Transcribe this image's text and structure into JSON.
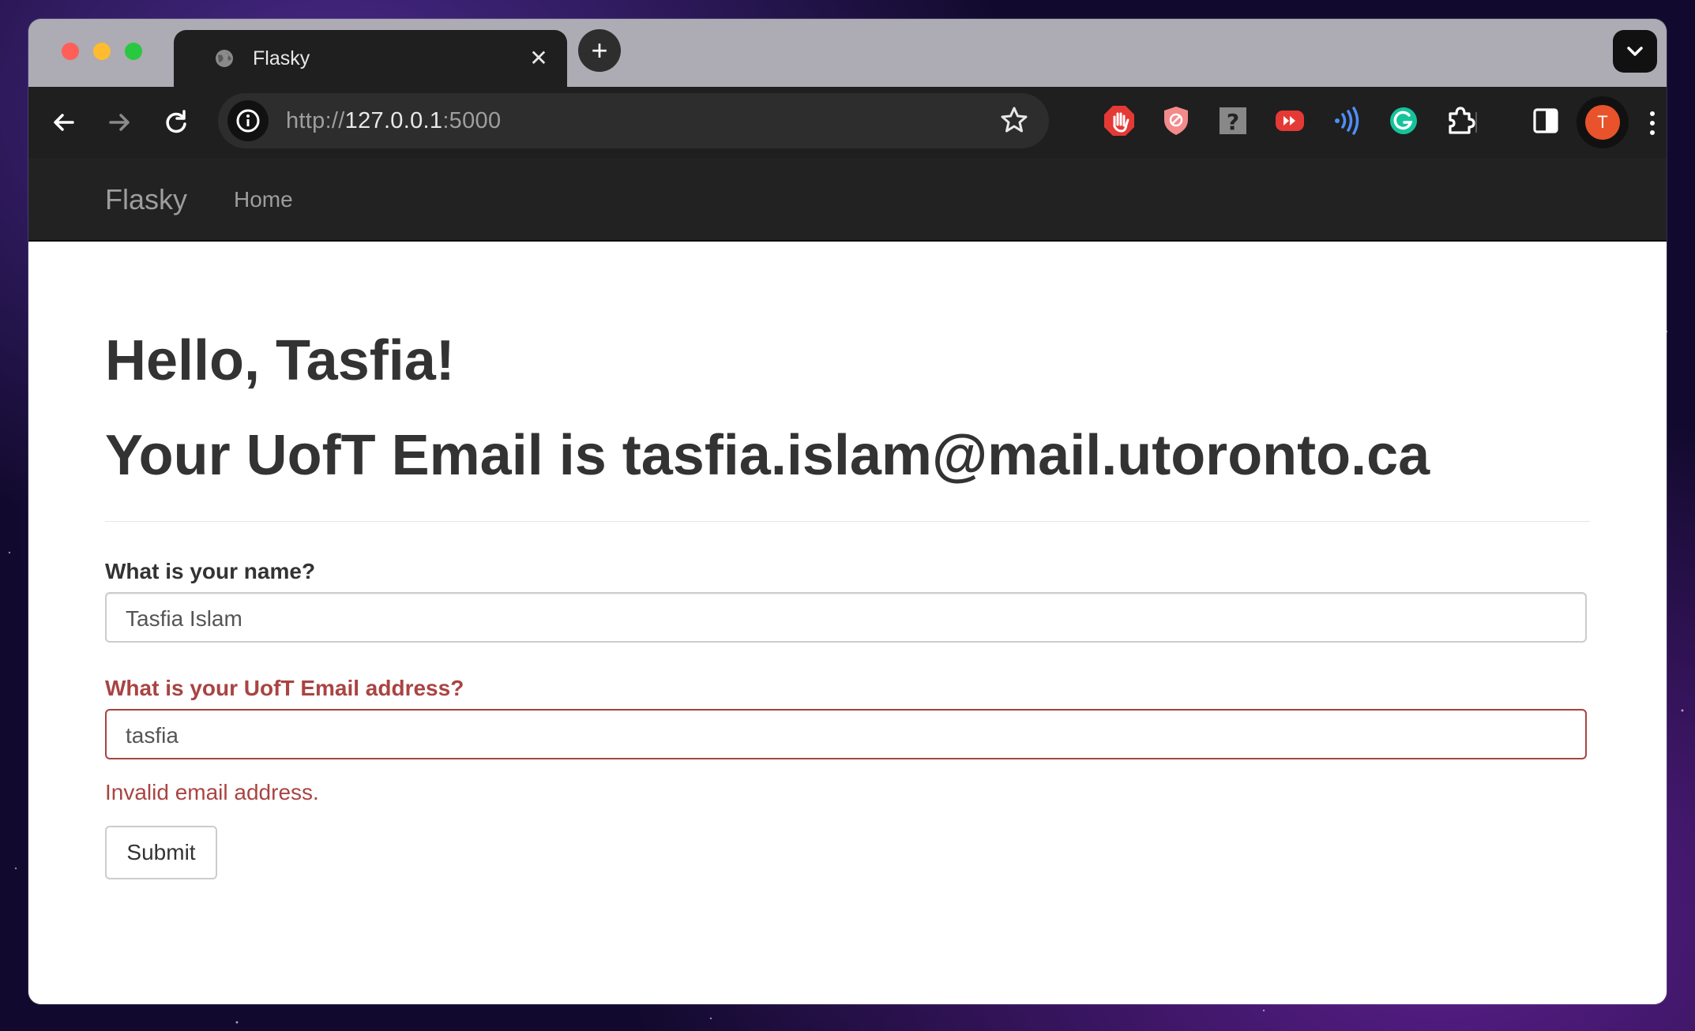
{
  "browser": {
    "tab_title": "Flasky",
    "url_scheme": "http://",
    "url_host": "127.0.0.1",
    "url_port": ":5000",
    "avatar_initial": "T",
    "new_tab_symbol": "+",
    "close_symbol": "✕"
  },
  "navbar": {
    "brand": "Flasky",
    "home": "Home"
  },
  "content": {
    "greeting": "Hello, Tasfia!",
    "email_heading": "Your UofT Email is tasfia.islam@mail.utoronto.ca"
  },
  "form": {
    "name_label": "What is your name?",
    "name_value": "Tasfia Islam",
    "email_label": "What is your UofT Email address?",
    "email_value": "tasfia",
    "email_error": "Invalid email address.",
    "submit_label": "Submit"
  },
  "colors": {
    "error": "#a94442",
    "navbar_bg": "#222222",
    "avatar_bg": "#e8532b"
  },
  "icons": {
    "extensions": [
      "adblock-hand-icon",
      "privacy-shield-icon",
      "help-question-icon",
      "video-speed-icon",
      "read-aloud-icon",
      "grammarly-icon",
      "puzzle-extensions-icon"
    ]
  }
}
